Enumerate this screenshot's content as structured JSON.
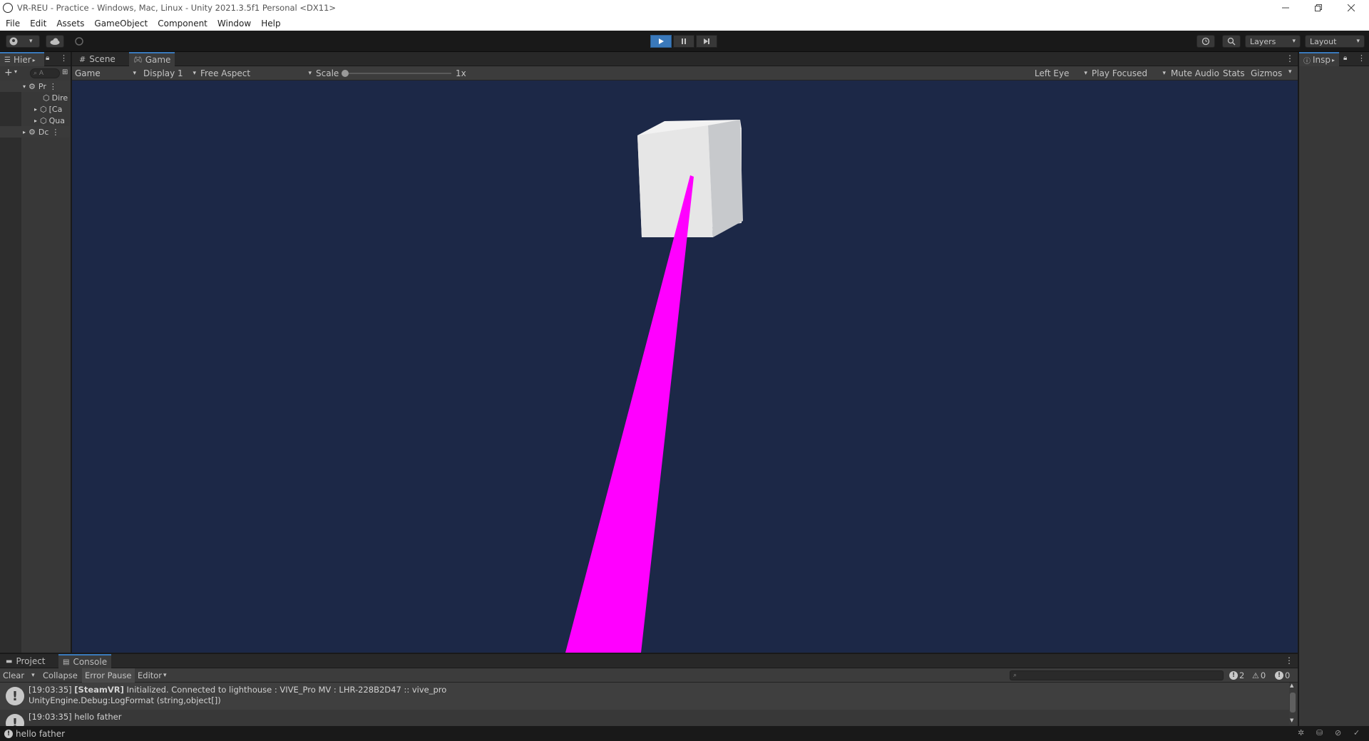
{
  "window": {
    "title": "VR-REU - Practice - Windows, Mac, Linux - Unity 2021.3.5f1 Personal <DX11>"
  },
  "menu": [
    "File",
    "Edit",
    "Assets",
    "GameObject",
    "Component",
    "Window",
    "Help"
  ],
  "toolbar": {
    "layers_label": "Layers",
    "layout_label": "Layout"
  },
  "hierarchy": {
    "tab_label": "Hier",
    "search_placeholder": "A",
    "rows": [
      {
        "label": "Pr",
        "kind": "scene"
      },
      {
        "label": "Dire",
        "kind": "object"
      },
      {
        "label": "[Ca",
        "kind": "object"
      },
      {
        "label": "Qua",
        "kind": "object"
      },
      {
        "label": "Dc",
        "kind": "scene"
      }
    ]
  },
  "center_tabs": {
    "scene": "Scene",
    "game": "Game"
  },
  "game_toolbar": {
    "view_mode": "Game",
    "display": "Display 1",
    "aspect": "Free Aspect",
    "scale_label": "Scale",
    "scale_value": "1x",
    "eye": "Left Eye",
    "play_mode": "Play Focused",
    "mute_audio": "Mute Audio",
    "stats": "Stats",
    "gizmos": "Gizmos"
  },
  "inspector": {
    "tab_label": "Insp"
  },
  "bottom_tabs": {
    "project": "Project",
    "console": "Console"
  },
  "console": {
    "clear": "Clear",
    "collapse": "Collapse",
    "error_pause": "Error Pause",
    "editor": "Editor",
    "log_count": "2",
    "warn_count": "0",
    "error_count": "0",
    "entries": [
      {
        "line1_time": "[19:03:35]",
        "line1_tag": "[SteamVR]",
        "line1_rest": "Initialized. Connected to lighthouse : VIVE_Pro MV : LHR-228B2D47 :: vive_pro",
        "line2": "UnityEngine.Debug:LogFormat (string,object[])"
      },
      {
        "line1_time": "[19:03:35]",
        "line1_rest": "hello father"
      }
    ]
  },
  "status": {
    "message": "hello father"
  },
  "colors": {
    "game_background": "#1c2847",
    "laser": "#ff00ff",
    "cube_front": "#e8e8e8",
    "cube_side": "#c7c9cc",
    "play_active": "#3a79bb"
  }
}
